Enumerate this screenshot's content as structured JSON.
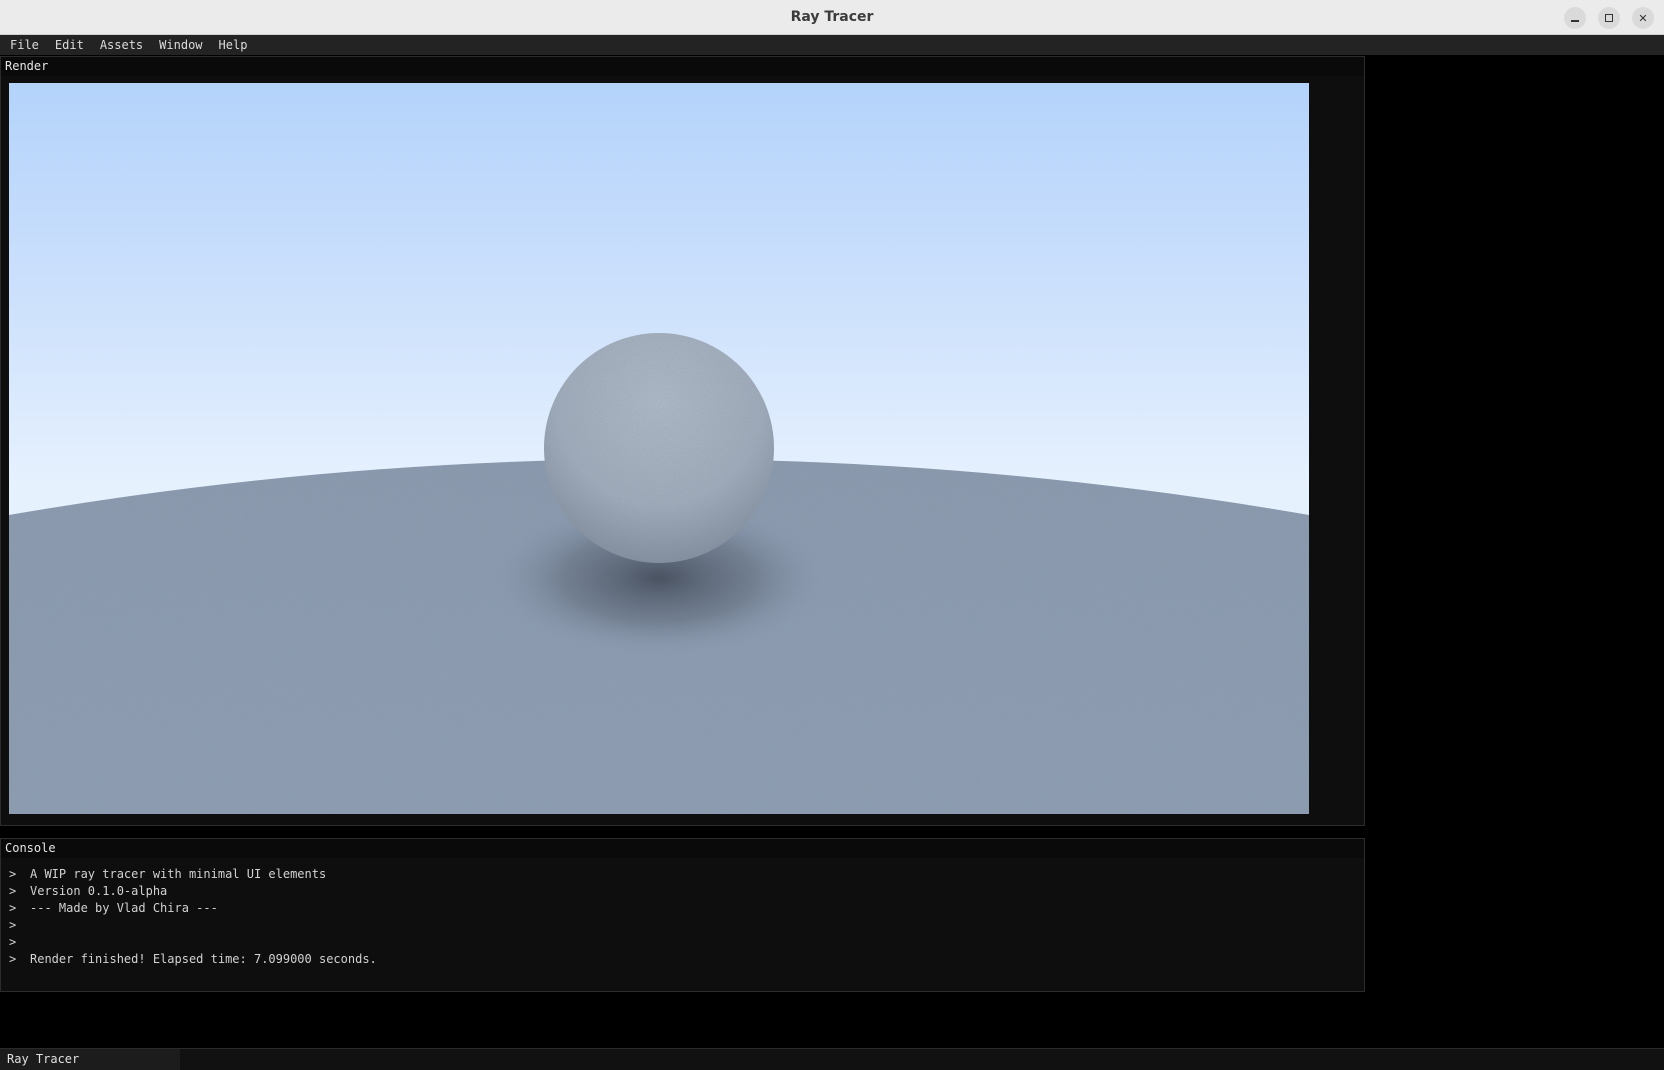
{
  "window": {
    "title": "Ray Tracer"
  },
  "menu": {
    "items": [
      "File",
      "Edit",
      "Assets",
      "Window",
      "Help"
    ]
  },
  "render_panel": {
    "title": "Render"
  },
  "console": {
    "title": "Console",
    "prompt": ">",
    "lines": [
      "A WIP ray tracer with minimal UI elements",
      "Version 0.1.0-alpha",
      "--- Made by Vlad Chira ---",
      "",
      "",
      "Render finished! Elapsed time: 7.099000 seconds."
    ]
  },
  "status_bar": {
    "tab_label": "Ray Tracer"
  },
  "colors": {
    "sky_top": "#b4d3fb",
    "sky_horizon": "#e6f1fe",
    "ground": "#8c9db4",
    "sphere": "#a3b0c0"
  }
}
